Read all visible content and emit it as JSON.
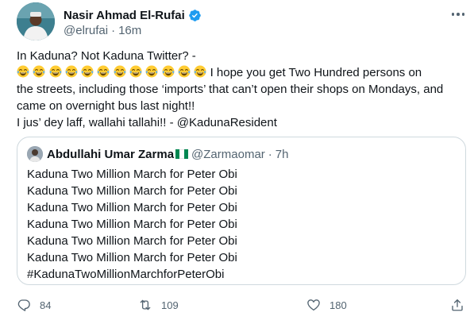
{
  "author": {
    "display_name": "Nasir Ahmad El-Rufai",
    "handle": "@elrufai",
    "separator": "·",
    "time": "16m",
    "verified": true
  },
  "tweet": {
    "line1": "In Kaduna? Not Kaduna Twitter? -",
    "emoji_name": "face-with-tears-of-joy",
    "emoji_count": 12,
    "line2_text": "I hope you get Two Hundred persons on",
    "line3": "the streets, including those ‘imports’ that can’t open their shops on Mondays, and",
    "line4": "came on overnight bus last night!!",
    "line5": "I jus’ dey laff, wallahi tallahi!! - @KadunaResident"
  },
  "quoted": {
    "display_name": "Abdullahi Umar Zarma",
    "flag": "nigeria-flag",
    "handle": "@Zarmaomar",
    "separator": "·",
    "time": "7h",
    "lines": [
      "Kaduna Two Million March for Peter Obi",
      "Kaduna Two Million March for Peter Obi",
      "Kaduna Two Million March for Peter Obi",
      "Kaduna Two Million March for Peter Obi",
      "Kaduna Two Million March for Peter Obi",
      "Kaduna Two Million March for Peter Obi",
      "#KadunaTwoMillionMarchforPeterObi"
    ]
  },
  "actions": {
    "reply_count": "84",
    "retweet_count": "109",
    "like_count": "180"
  },
  "colors": {
    "text": "#0f1419",
    "secondary": "#536471",
    "verified": "#1d9bf0",
    "border": "#cfd9de"
  }
}
